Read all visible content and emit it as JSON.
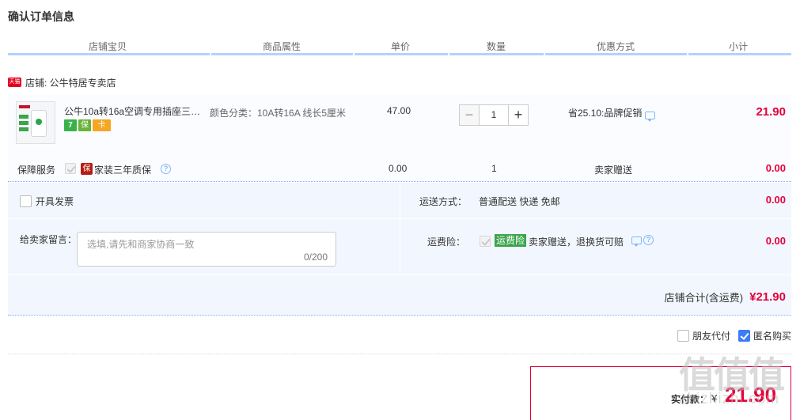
{
  "section_title": "确认订单信息",
  "columns": [
    "店铺宝贝",
    "商品属性",
    "单价",
    "数量",
    "优惠方式",
    "小计"
  ],
  "shop": {
    "badge": "天猫",
    "label": "店铺: 公牛特居专卖店"
  },
  "item": {
    "title": "公牛10a转16a空调专用插座三…",
    "attr": "颜色分类：10A转16A 线长5厘米",
    "price": "47.00",
    "qty_minus": "−",
    "qty_value": "1",
    "qty_plus": "+",
    "promo": "省25.10:品牌促销",
    "subtotal": "21.90",
    "service_icons": [
      "7",
      "保",
      "卡"
    ]
  },
  "guarantee": {
    "label": "保障服务",
    "badge": "保",
    "text": "家装三年质保",
    "help": "?",
    "price": "0.00",
    "qty": "1",
    "promo": "卖家赠送",
    "subtotal": "0.00"
  },
  "invoice": {
    "label": "开具发票"
  },
  "message": {
    "label": "给卖家留言：",
    "placeholder": "选填,请先和商家协商一致",
    "counter": "0/200"
  },
  "shipping": {
    "label": "运送方式：",
    "value": "普通配送 快递 免邮",
    "price": "0.00"
  },
  "insurance": {
    "label": "运费险：",
    "badge": "运费险",
    "text": "卖家赠送，退换货可赔",
    "help": "?",
    "price": "0.00"
  },
  "shop_total": {
    "label": "店铺合计(含运费)",
    "amount": "¥21.90"
  },
  "extras": {
    "friend_pay": "朋友代付",
    "anonymous": "匿名购买",
    "anonymous_checked": true
  },
  "payment": {
    "label": "实付款：",
    "currency": "¥",
    "amount": "21.90"
  },
  "watermark": {
    "big": "值值值",
    "small": "zhizhizhi.com"
  },
  "colors": {
    "price_red": "#e4003a",
    "header_border": "#b2d1ff",
    "options_bg": "#f2f7ff",
    "check_blue": "#3d7bf7"
  }
}
